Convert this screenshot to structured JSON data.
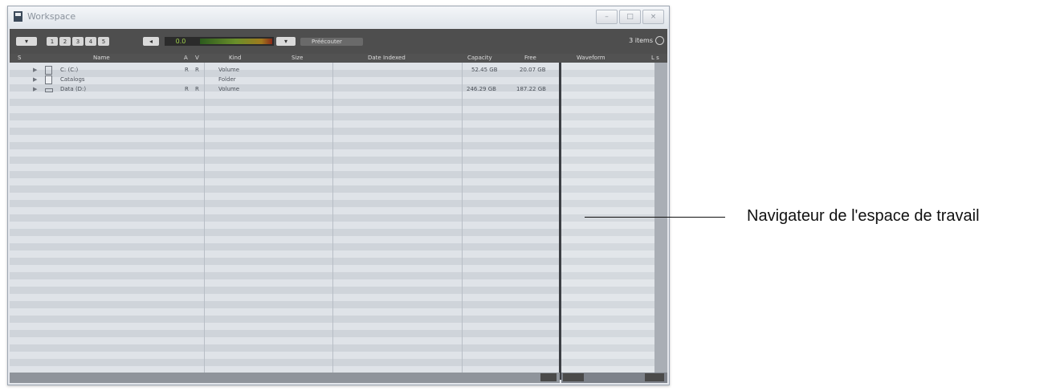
{
  "window": {
    "title": "Workspace",
    "controls": [
      "–",
      "□",
      "×"
    ]
  },
  "toolbar": {
    "view_buttons": [
      "1",
      "2",
      "3",
      "4",
      "5"
    ],
    "meter_value": "0.0",
    "preview_label": "Préécouter",
    "items_count": "3 items"
  },
  "columns": {
    "state": "S",
    "name": "Name",
    "a": "A",
    "v": "V",
    "kind": "Kind",
    "size": "Size",
    "date_indexed": "Date Indexed",
    "capacity": "Capacity",
    "free": "Free",
    "waveform": "Waveform",
    "extra": "L s"
  },
  "rows": [
    {
      "name": "C: (C:)",
      "a": "R",
      "v": "R",
      "kind": "Volume",
      "capacity": "52.45 GB",
      "free": "20.07 GB"
    },
    {
      "name": "Catalogs",
      "a": "",
      "v": "",
      "kind": "Folder",
      "capacity": "",
      "free": ""
    },
    {
      "name": "Data (D:)",
      "a": "R",
      "v": "R",
      "kind": "Volume",
      "capacity": "246.29 GB",
      "free": "187.22 GB"
    }
  ],
  "annotation": {
    "label": "Navigateur de l'espace de travail"
  }
}
